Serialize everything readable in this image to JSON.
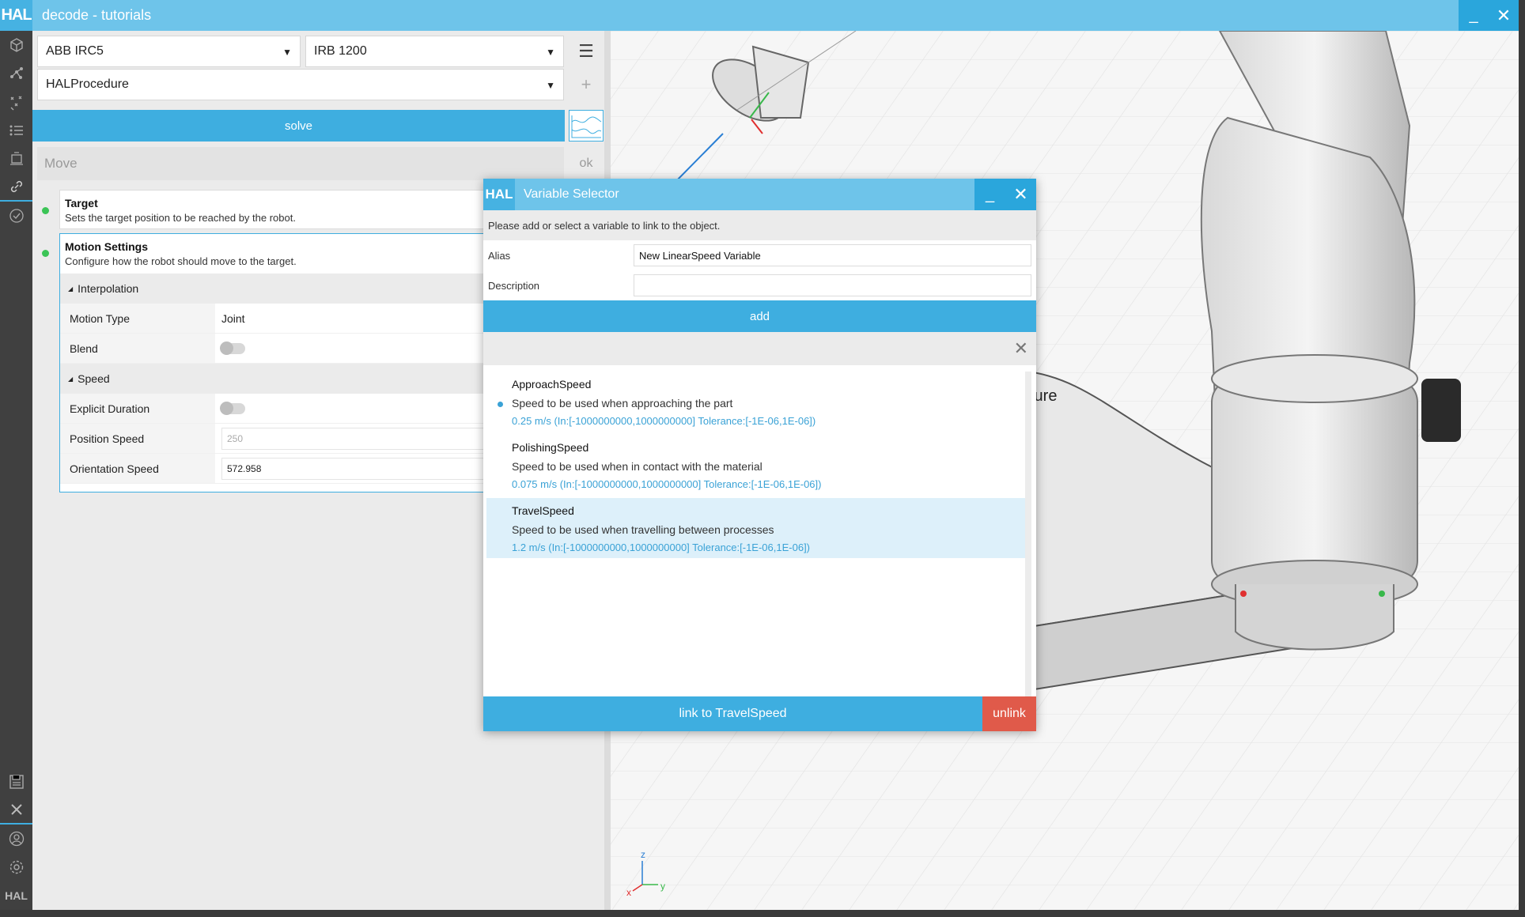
{
  "app": {
    "logo": "HAL",
    "title": "decode - tutorials",
    "minimize": "_",
    "close": "✕"
  },
  "sidebar": {
    "icons": [
      "cube-icon",
      "network-icon",
      "scatter-icon",
      "list-icon",
      "robot-icon",
      "link-icon",
      "check-icon"
    ],
    "bottom_icons": [
      "save-icon",
      "close-icon",
      "user-icon",
      "gear-icon"
    ],
    "footer_logo": "HAL"
  },
  "left": {
    "controller": "ABB IRC5",
    "robot": "IRB 1200",
    "procedure": "HALProcedure",
    "solve_label": "solve",
    "move_placeholder": "Move",
    "ok_label": "ok",
    "target": {
      "title": "Target",
      "desc": "Sets the target position to be reached by the robot."
    },
    "motion": {
      "title": "Motion Settings",
      "desc": "Configure how the robot should move to the target.",
      "interpolation_label": "Interpolation",
      "motion_type_label": "Motion Type",
      "motion_type_value": "Joint",
      "blend_label": "Blend",
      "speed_label": "Speed",
      "explicit_duration_label": "Explicit Duration",
      "position_speed_label": "Position Speed",
      "position_speed_value": "250",
      "orientation_speed_label": "Orientation Speed",
      "orientation_speed_value": "572.958"
    }
  },
  "viewport": {
    "overlay_text": "cture",
    "axis_z": "z",
    "axis_x": "x",
    "axis_y": "y"
  },
  "dialog": {
    "logo": "HAL",
    "title": "Variable Selector",
    "minimize": "_",
    "close": "✕",
    "hint": "Please add or select a variable to link to the object.",
    "alias_label": "Alias",
    "alias_value": "New LinearSpeed Variable",
    "description_label": "Description",
    "description_value": "",
    "add_label": "add",
    "clear_icon": "✕",
    "variables": [
      {
        "name": "ApproachSpeed",
        "desc": "Speed to be used when approaching the part",
        "meta": "0.25 m/s (In:[-1000000000,1000000000] Tolerance:[-1E-06,1E-06])"
      },
      {
        "name": "PolishingSpeed",
        "desc": "Speed to be used when in contact with the material",
        "meta": "0.075 m/s (In:[-1000000000,1000000000] Tolerance:[-1E-06,1E-06])"
      },
      {
        "name": "TravelSpeed",
        "desc": "Speed to be used when travelling between processes",
        "meta": "1.2 m/s (In:[-1000000000,1000000000] Tolerance:[-1E-06,1E-06])"
      }
    ],
    "link_label": "link to TravelSpeed",
    "unlink_label": "unlink"
  },
  "colors": {
    "accent": "#3eaee0",
    "titlebar": "#6ec4ea",
    "danger": "#e05a4a",
    "status_ok": "#3bc456"
  }
}
